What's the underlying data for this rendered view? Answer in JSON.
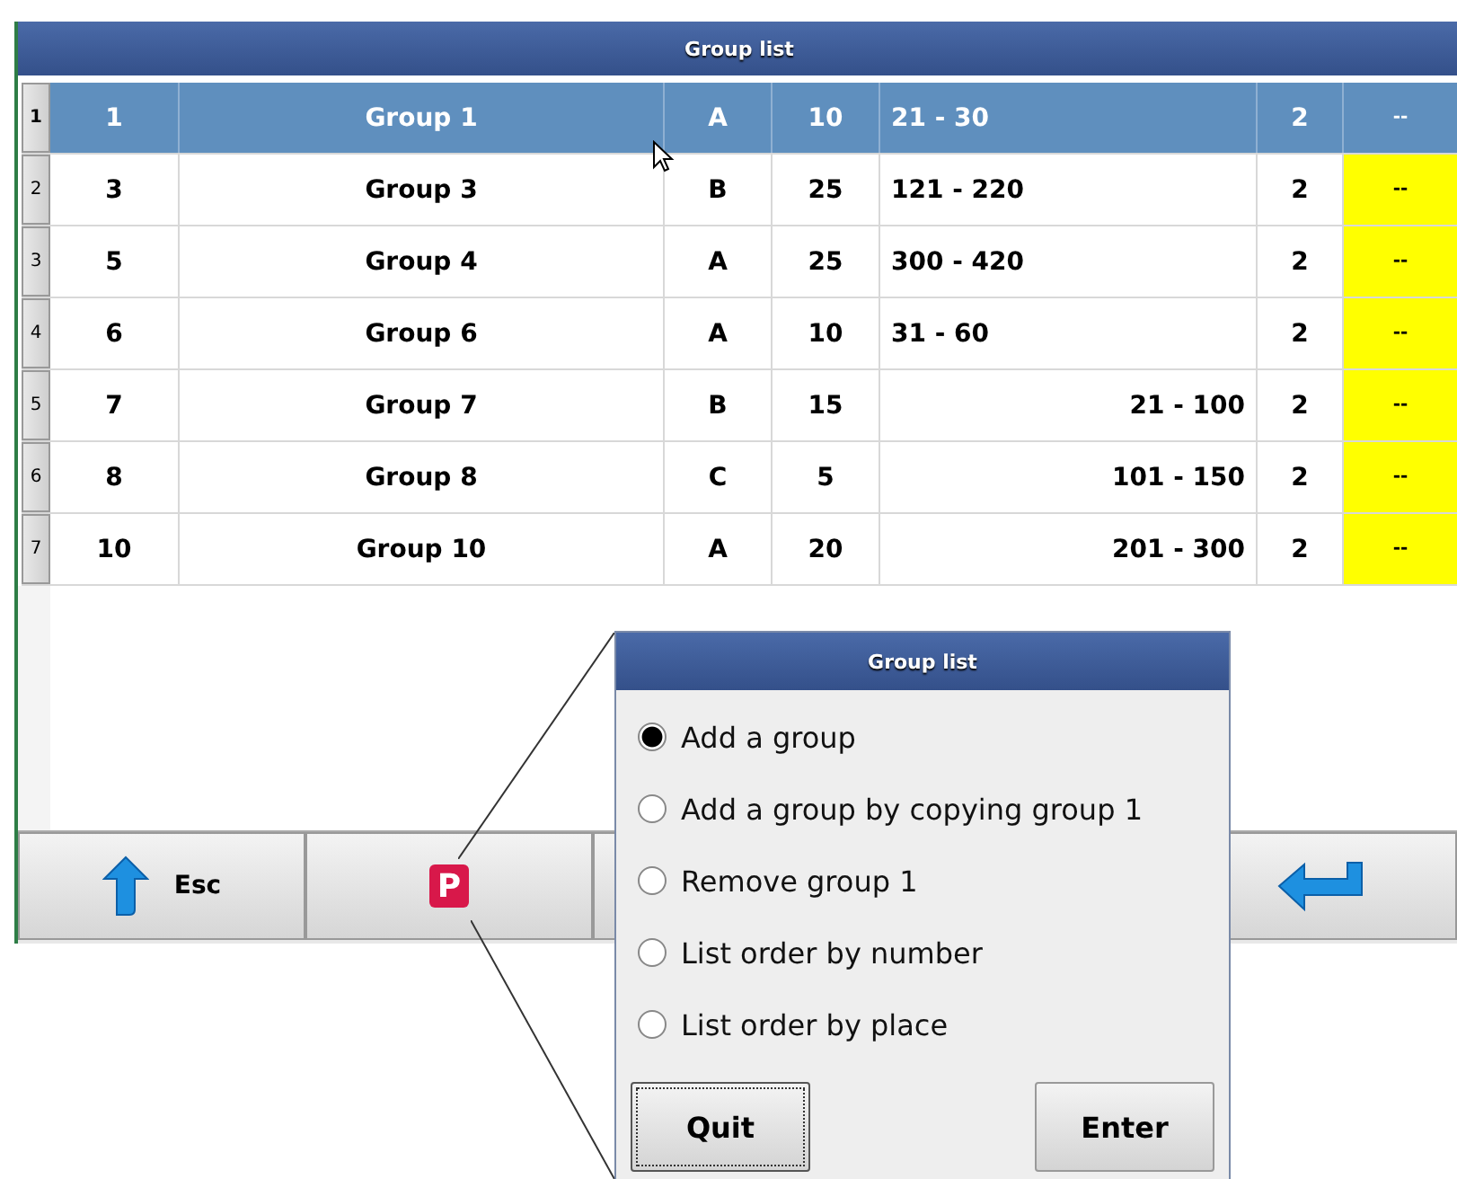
{
  "window": {
    "title": "Group list"
  },
  "table": {
    "rows": [
      {
        "number": "1",
        "selected": true,
        "cells": [
          "1",
          "Group 1",
          "A",
          "10",
          "21 - 30",
          "2",
          "--"
        ],
        "range_right": false
      },
      {
        "number": "2",
        "selected": false,
        "cells": [
          "3",
          "Group 3",
          "B",
          "25",
          "121 - 220",
          "2",
          "--"
        ],
        "range_right": false
      },
      {
        "number": "3",
        "selected": false,
        "cells": [
          "5",
          "Group 4",
          "A",
          "25",
          "300 - 420",
          "2",
          "--"
        ],
        "range_right": false
      },
      {
        "number": "4",
        "selected": false,
        "cells": [
          "6",
          "Group 6",
          "A",
          "10",
          "31 - 60",
          "2",
          "--"
        ],
        "range_right": false
      },
      {
        "number": "5",
        "selected": false,
        "cells": [
          "7",
          "Group 7",
          "B",
          "15",
          "21 - 100",
          "2",
          "--"
        ],
        "range_right": true
      },
      {
        "number": "6",
        "selected": false,
        "cells": [
          "8",
          "Group 8",
          "C",
          "5",
          "101 - 150",
          "2",
          "--"
        ],
        "range_right": true
      },
      {
        "number": "7",
        "selected": false,
        "cells": [
          "10",
          "Group 10",
          "A",
          "20",
          "201 - 300",
          "2",
          "--"
        ],
        "range_right": true
      }
    ]
  },
  "toolbar": {
    "esc_label": "Esc",
    "logo_letter": "P"
  },
  "dialog": {
    "title": "Group list",
    "options": [
      {
        "label": "Add a group",
        "selected": true
      },
      {
        "label": "Add a group by copying group 1",
        "selected": false
      },
      {
        "label": "Remove group 1",
        "selected": false
      },
      {
        "label": "List order by number",
        "selected": false
      },
      {
        "label": "List order by place",
        "selected": false
      }
    ],
    "buttons": [
      "Quit",
      "Enter"
    ]
  }
}
